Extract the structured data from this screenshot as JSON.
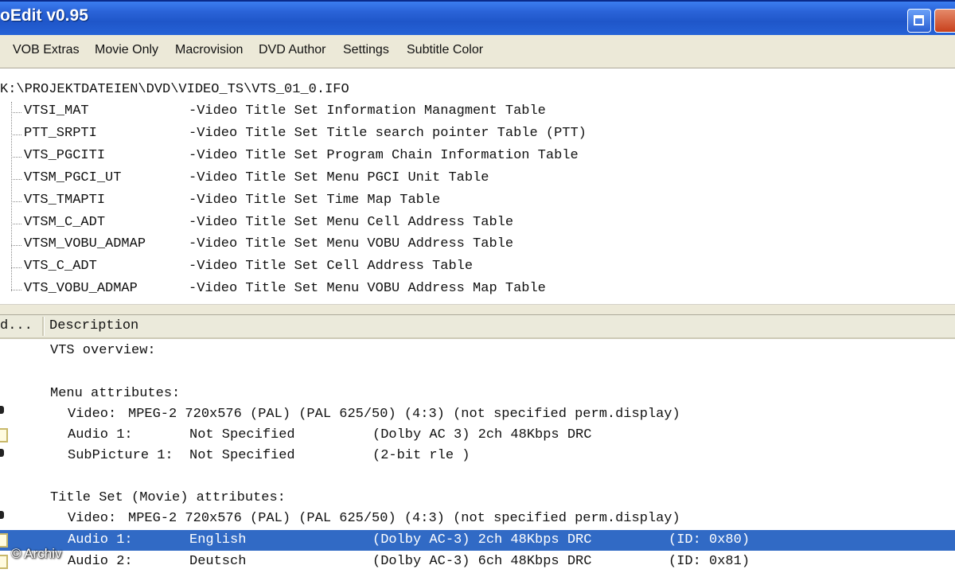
{
  "window": {
    "title": "oEdit v0.95"
  },
  "menu": [
    "VOB Extras",
    "Movie Only",
    "Macrovision",
    "DVD Author",
    "Settings",
    "Subtitle Color"
  ],
  "tree": {
    "root_path": "K:\\PROJEKTDATEIEN\\DVD\\VIDEO_TS\\VTS_01_0.IFO",
    "items": [
      {
        "code": "VTSI_MAT",
        "desc": "-Video Title Set Information Managment Table"
      },
      {
        "code": "PTT_SRPTI",
        "desc": "-Video Title Set Title search pointer Table (PTT)"
      },
      {
        "code": "VTS_PGCITI",
        "desc": "-Video Title Set Program Chain Information Table"
      },
      {
        "code": "VTSM_PGCI_UT",
        "desc": "-Video Title Set Menu PGCI Unit Table"
      },
      {
        "code": "VTS_TMAPTI",
        "desc": "-Video Title Set Time Map Table"
      },
      {
        "code": "VTSM_C_ADT",
        "desc": "-Video Title Set Menu Cell Address Table"
      },
      {
        "code": "VTSM_VOBU_ADMAP",
        "desc": "-Video Title Set Menu VOBU Address Table"
      },
      {
        "code": "VTS_C_ADT",
        "desc": "-Video Title Set Cell Address Table"
      },
      {
        "code": "VTS_VOBU_ADMAP",
        "desc": "-Video Title Set Menu VOBU Address Map Table"
      }
    ]
  },
  "columns": {
    "first": "d...",
    "second": "Description"
  },
  "description": {
    "vts_overview": "VTS overview:",
    "menu_attrs": "Menu attributes:",
    "menu_video": {
      "label": "Video:",
      "value": "MPEG-2 720x576 (PAL) (PAL 625/50) (4:3) (not specified perm.display)"
    },
    "menu_audio1": {
      "label": "Audio 1:",
      "value": "Not Specified",
      "format": "(Dolby AC 3) 2ch 48Kbps DRC"
    },
    "menu_subpic1": {
      "label": "SubPicture 1:",
      "value": "Not Specified",
      "format": "(2-bit rle )"
    },
    "title_set_attrs": "Title Set (Movie) attributes:",
    "ts_video": {
      "label": "Video:",
      "value": "MPEG-2 720x576 (PAL) (PAL 625/50) (4:3) (not specified perm.display)"
    },
    "ts_audio1": {
      "label": "Audio 1:",
      "value": "English",
      "format": "(Dolby AC-3) 2ch 48Kbps DRC",
      "id": "(ID: 0x80)"
    },
    "ts_audio2": {
      "label": "Audio 2:",
      "value": "Deutsch",
      "format": "(Dolby AC-3) 6ch 48Kbps DRC",
      "id": "(ID: 0x81)"
    }
  },
  "watermark": "© Archiv",
  "colors": {
    "titlebar": "#2a63d8",
    "selection": "#316ac5",
    "menubar": "#ece9d8"
  }
}
